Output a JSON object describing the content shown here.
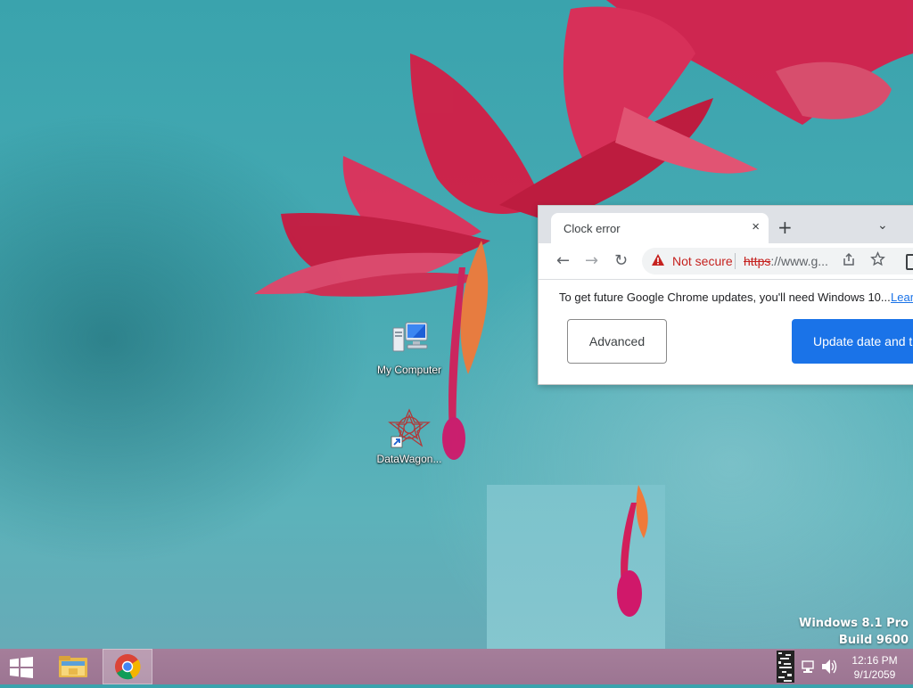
{
  "desktop": {
    "icons": [
      {
        "label": "My Computer"
      },
      {
        "label": "DataWagon..."
      }
    ],
    "watermark": {
      "line1": "Windows 8.1 Pro",
      "line2": "Build 9600"
    }
  },
  "browser": {
    "tab": {
      "title": "Clock error",
      "close_icon": "×"
    },
    "new_tab_icon": "+",
    "tab_menu_icon": "⌄",
    "toolbar": {
      "back_icon": "←",
      "forward_icon": "→",
      "reload_icon": "↻",
      "security_label": "Not secure",
      "url_scheme": "https",
      "url_rest": "://www.g..."
    },
    "infobar": {
      "message": "To get future Google Chrome updates, you'll need Windows 10...",
      "link": "Learn"
    },
    "buttons": {
      "advanced": "Advanced",
      "update": "Update date and t"
    }
  },
  "taskbar": {
    "clock": {
      "time": "12:16 PM",
      "date": "9/1/2059"
    }
  },
  "colors": {
    "accent": "#1a73e8",
    "error": "#c5221f",
    "taskbar": "#a07a96"
  }
}
